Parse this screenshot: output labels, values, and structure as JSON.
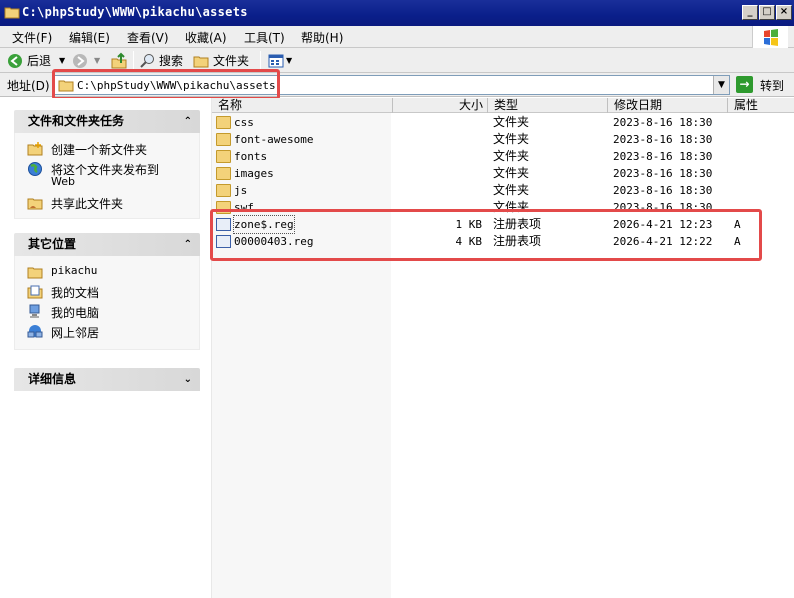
{
  "window": {
    "title": "C:\\phpStudy\\WWW\\pikachu\\assets",
    "controls": {
      "minimize": "_",
      "maximize": "□",
      "close": "×"
    }
  },
  "menu": {
    "items": [
      "文件(F)",
      "编辑(E)",
      "查看(V)",
      "收藏(A)",
      "工具(T)",
      "帮助(H)"
    ]
  },
  "toolbar": {
    "back_label": "后退",
    "search_label": "搜索",
    "folders_label": "文件夹"
  },
  "address": {
    "label": "地址(D)",
    "value": "C:\\phpStudy\\WWW\\pikachu\\assets",
    "go_label": "转到"
  },
  "tasks_panel": {
    "title": "文件和文件夹任务",
    "items": [
      {
        "label": "创建一个新文件夹",
        "icon": "new-folder-icon"
      },
      {
        "label": "将这个文件夹发布到",
        "label2": "Web",
        "icon": "publish-web-icon"
      },
      {
        "label": "共享此文件夹",
        "icon": "share-folder-icon"
      }
    ]
  },
  "places_panel": {
    "title": "其它位置",
    "items": [
      {
        "label": "pikachu",
        "icon": "folder-icon"
      },
      {
        "label": "我的文档",
        "icon": "my-documents-icon"
      },
      {
        "label": "我的电脑",
        "icon": "my-computer-icon"
      },
      {
        "label": "网上邻居",
        "icon": "network-icon"
      }
    ]
  },
  "details_panel": {
    "title": "详细信息"
  },
  "file_list": {
    "columns": [
      "名称",
      "大小",
      "类型",
      "修改日期",
      "属性"
    ],
    "rows": [
      {
        "name": "css",
        "size": "",
        "type": "文件夹",
        "date": "2023-8-16 18:30",
        "attr": "",
        "kind": "folder"
      },
      {
        "name": "font-awesome",
        "size": "",
        "type": "文件夹",
        "date": "2023-8-16 18:30",
        "attr": "",
        "kind": "folder"
      },
      {
        "name": "fonts",
        "size": "",
        "type": "文件夹",
        "date": "2023-8-16 18:30",
        "attr": "",
        "kind": "folder"
      },
      {
        "name": "images",
        "size": "",
        "type": "文件夹",
        "date": "2023-8-16 18:30",
        "attr": "",
        "kind": "folder"
      },
      {
        "name": "js",
        "size": "",
        "type": "文件夹",
        "date": "2023-8-16 18:30",
        "attr": "",
        "kind": "folder"
      },
      {
        "name": "swf",
        "size": "",
        "type": "文件夹",
        "date": "2023-8-16 18:30",
        "attr": "",
        "kind": "folder"
      },
      {
        "name": "zone$.reg",
        "size": "1 KB",
        "type": "注册表项",
        "date": "2026-4-21 12:23",
        "attr": "A",
        "kind": "reg"
      },
      {
        "name": "00000403.reg",
        "size": "4 KB",
        "type": "注册表项",
        "date": "2026-4-21 12:22",
        "attr": "A",
        "kind": "reg"
      }
    ]
  },
  "colors": {
    "titlebar": "#0a1f8a",
    "highlight_box": "#e34a4a",
    "go_button": "#2e9a2e"
  }
}
